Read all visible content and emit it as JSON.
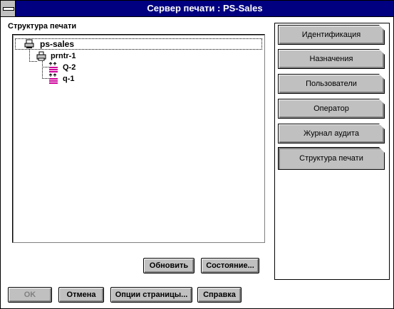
{
  "window": {
    "title": "Сервер печати : PS-Sales"
  },
  "tree": {
    "label": "Структура печати",
    "items": [
      {
        "label": "ps-sales",
        "icon": "server-icon"
      },
      {
        "label": "prntr-1",
        "icon": "printer-icon"
      },
      {
        "label": "Q-2",
        "icon": "queue-icon"
      },
      {
        "label": "q-1",
        "icon": "queue-icon"
      }
    ]
  },
  "tree_buttons": {
    "refresh": "Обновить",
    "status": "Состояние..."
  },
  "tabs": [
    {
      "label": "Идентификация"
    },
    {
      "label": "Назначения"
    },
    {
      "label": "Пользователи"
    },
    {
      "label": "Оператор"
    },
    {
      "label": "Журнал аудита"
    },
    {
      "label": "Структура печати",
      "active": true
    }
  ],
  "bottom_buttons": {
    "ok": "OK",
    "cancel": "Отмена",
    "page_options": "Опции страницы...",
    "help": "Справка"
  },
  "colors": {
    "titlebar": "#000080",
    "button_face": "#c0c0c0",
    "queue_icon": "#cc0099"
  }
}
